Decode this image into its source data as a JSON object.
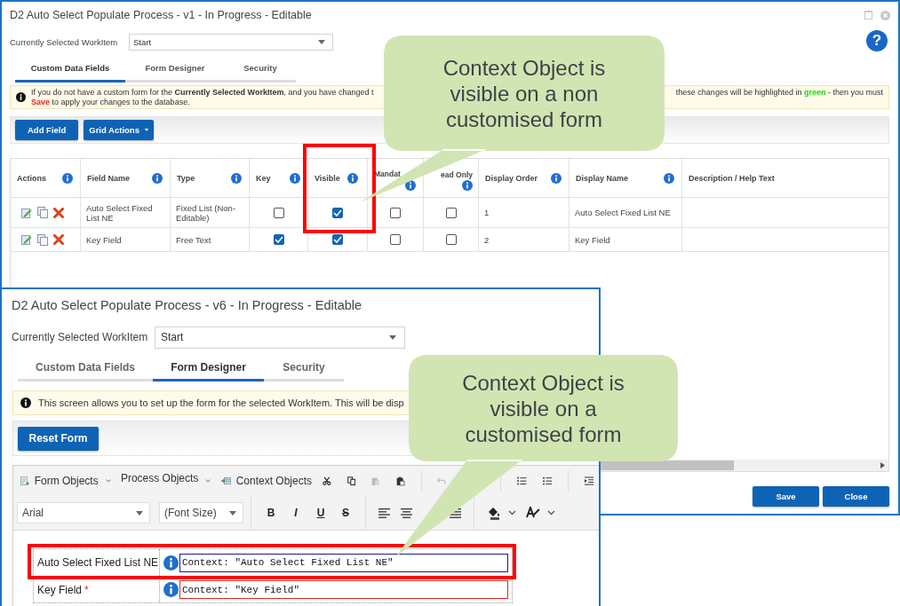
{
  "back_window": {
    "title": "D2 Auto Select Populate Process - v1 - In Progress - Editable",
    "help": "?",
    "workitem_label": "Currently Selected WorkItem",
    "workitem_value": "Start",
    "tabs": [
      {
        "label": "Custom Data Fields",
        "selected": true
      },
      {
        "label": "Form Designer",
        "selected": false
      },
      {
        "label": "Security",
        "selected": false
      }
    ],
    "info": {
      "left": [
        {
          "text": "If you do not have a custom form for the ",
          "kind": "plain"
        },
        {
          "text": "Currently Selected WorkItem",
          "kind": "bold"
        },
        {
          "text": ", and you have changed t",
          "kind": "plain"
        }
      ],
      "right": [
        {
          "text": "these changes will be highlighted in ",
          "kind": "plain"
        },
        {
          "text": "green",
          "kind": "colored",
          "color": "#1cd61c"
        },
        {
          "text": " - then you must",
          "kind": "plain"
        }
      ],
      "second_line": [
        {
          "text": "Save",
          "kind": "colored",
          "color": "#e42323"
        },
        {
          "text": " to apply your changes to the database.",
          "kind": "plain"
        }
      ]
    },
    "toolbar_buttons": [
      {
        "label": "Add Field",
        "kind": "plain"
      },
      {
        "label": "Grid Actions",
        "kind": "dropdown"
      }
    ],
    "columns": [
      {
        "label": "Actions",
        "info": true
      },
      {
        "label": "Field Name",
        "info": true
      },
      {
        "label": "Type",
        "info": true
      },
      {
        "label": "Key",
        "info": true
      },
      {
        "label": "Visible",
        "info": true
      },
      {
        "label": "Mandat",
        "info": true
      },
      {
        "label": "ead Only",
        "info": true
      },
      {
        "label": "Display Order",
        "info": true
      },
      {
        "label": "Display Name",
        "info": true
      },
      {
        "label": "Description / Help Text",
        "info": false
      }
    ],
    "rows": [
      {
        "field_name": "Auto Select Fixed List NE",
        "type": "Fixed List (Non-Editable)",
        "key": false,
        "visible": true,
        "mandatory": false,
        "read_only": false,
        "display_order": "1",
        "display_name": "Auto Select Fixed List NE"
      },
      {
        "field_name": "Key Field",
        "type": "Free Text",
        "key": true,
        "visible": true,
        "mandatory": false,
        "read_only": false,
        "display_order": "2",
        "display_name": "Key Field"
      }
    ],
    "footer_buttons": [
      "Save",
      "Close"
    ]
  },
  "front_window": {
    "title": "D2 Auto Select Populate Process - v6 - In Progress - Editable",
    "workitem_label": "Currently Selected WorkItem",
    "workitem_value": "Start",
    "tabs": [
      {
        "label": "Custom Data Fields",
        "selected": false
      },
      {
        "label": "Form Designer",
        "selected": true
      },
      {
        "label": "Security",
        "selected": false
      }
    ],
    "info": "This screen allows you to set up the form for the selected WorkItem. This will be disp",
    "reset_button": "Reset Form",
    "menus": [
      {
        "label": "Form Objects",
        "kind": "icon-dropdown"
      },
      {
        "label": "Process Objects",
        "kind": "dropdown"
      },
      {
        "label": "Context Objects",
        "kind": "icon"
      }
    ],
    "font_select": "Arial",
    "size_select": "(Font Size)",
    "format_buttons": [
      "B",
      "I",
      "U",
      "S"
    ],
    "fields": [
      {
        "label": "Auto Select Fixed List NE",
        "value": "Context: \"Auto Select Fixed List NE\"",
        "focused": true,
        "invalid": false
      },
      {
        "label": "Key Field",
        "required_mark": "*",
        "value": "Context: \"Key Field\"",
        "focused": false,
        "invalid": true
      }
    ]
  },
  "callouts": [
    {
      "text": "Context Object is visible on a non customised form"
    },
    {
      "text": "Context Object is visible on a customised form"
    }
  ]
}
